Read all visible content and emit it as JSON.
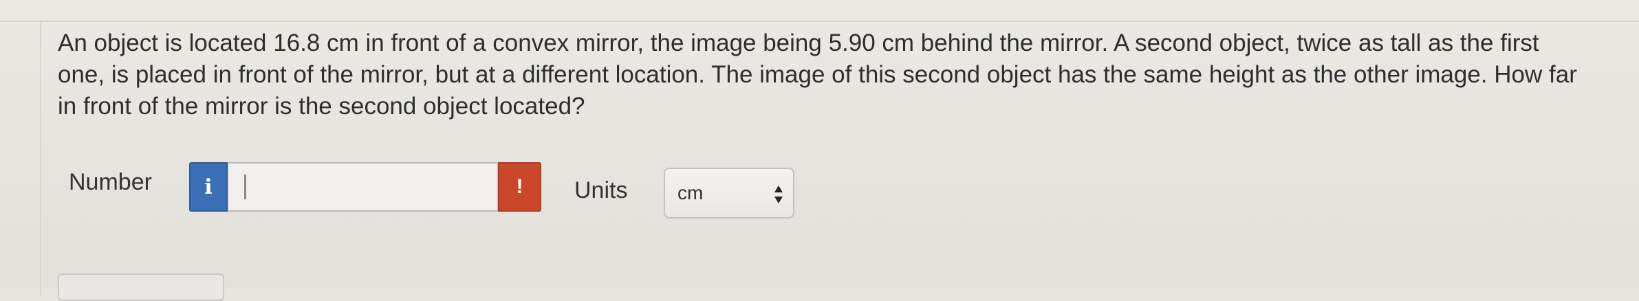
{
  "question": {
    "text": "An object is located 16.8 cm in front of a convex mirror, the image being 5.90 cm behind the mirror. A second object, twice as tall as the first one, is placed in front of the mirror, but at a different location. The image of this second object has the same height as the other image. How far in front of the mirror is the second object located?"
  },
  "answer": {
    "number_label": "Number",
    "info_icon": "i",
    "number_value": "",
    "error_icon": "!",
    "units_label": "Units",
    "units_selected": "cm"
  },
  "icons": {
    "info": "info-icon",
    "error": "exclamation-icon",
    "select": "up-down-arrows-icon"
  },
  "colors": {
    "info_button": "#3b70b4",
    "error_flag": "#c9482b",
    "background": "#e7e5e0",
    "text": "#2e2e2e"
  }
}
